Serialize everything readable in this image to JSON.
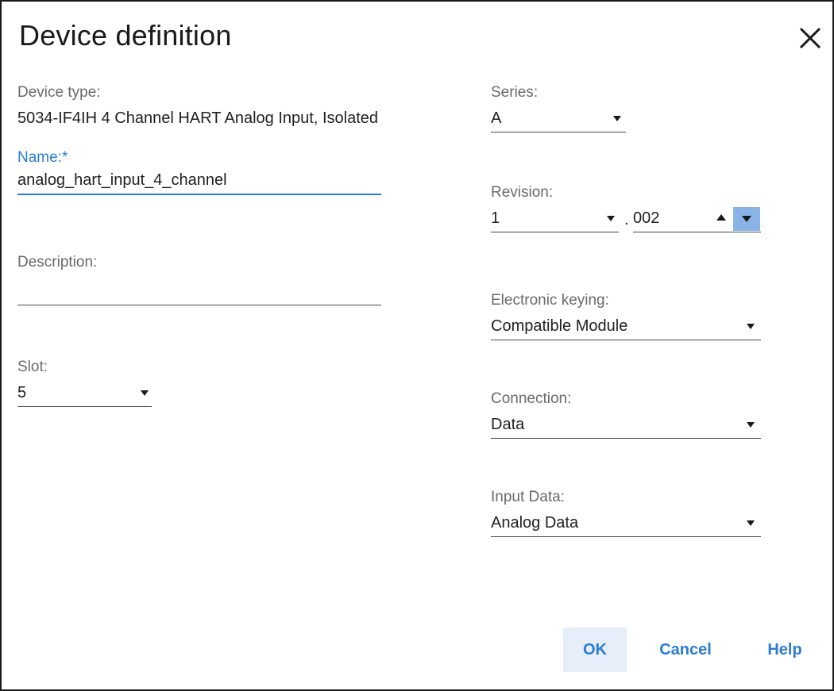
{
  "dialog": {
    "title": "Device definition",
    "close_icon": "close-icon"
  },
  "device_type": {
    "label": "Device type:",
    "value": "5034-IF4IH 4 Channel HART Analog Input, Isolated"
  },
  "name": {
    "label": "Name:*",
    "value": "analog_hart_input_4_channel"
  },
  "description": {
    "label": "Description:",
    "value": ""
  },
  "slot": {
    "label": "Slot:",
    "value": "5"
  },
  "series": {
    "label": "Series:",
    "value": "A"
  },
  "revision": {
    "label": "Revision:",
    "major": "1",
    "separator": ".",
    "minor": "002"
  },
  "electronic_keying": {
    "label": "Electronic keying:",
    "value": "Compatible Module"
  },
  "connection": {
    "label": "Connection:",
    "value": "Data"
  },
  "input_data": {
    "label": "Input Data:",
    "value": "Analog Data"
  },
  "buttons": {
    "ok": "OK",
    "cancel": "Cancel",
    "help": "Help"
  },
  "colors": {
    "accent": "#2b7cd3",
    "label": "#6a6a6a",
    "primary_button_bg": "#e5eef9",
    "spin_highlight": "#8ab4e8"
  }
}
